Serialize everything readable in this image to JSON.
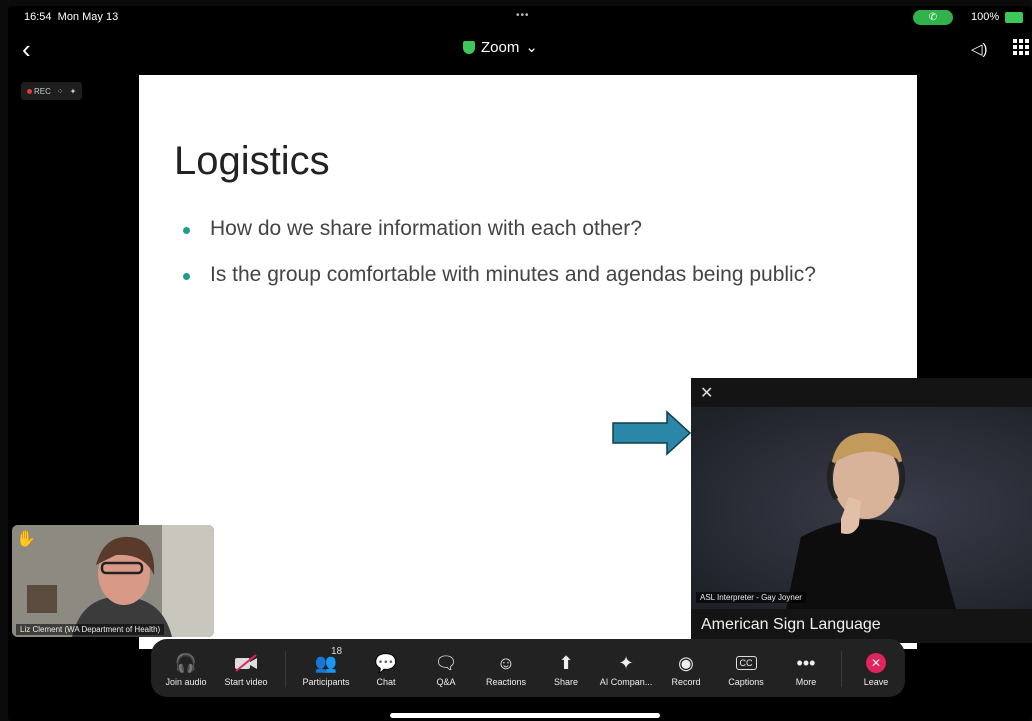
{
  "status": {
    "time": "16:54",
    "date": "Mon May 13",
    "battery": "100%"
  },
  "app": {
    "title": "Zoom"
  },
  "recording": {
    "label": "REC"
  },
  "slide": {
    "title": "Logistics",
    "bullets": [
      "How do we share information with each other?",
      "Is the group comfortable with minutes and agendas being public?"
    ]
  },
  "interpreter": {
    "name": "ASL Interpreter - Gay Joyner",
    "language_label": "American Sign Language"
  },
  "self_view": {
    "name": "Liz Clement (WA Department of Health)"
  },
  "toolbar": {
    "join_audio": "Join audio",
    "start_video": "Start video",
    "participants": "Participants",
    "participants_count": "18",
    "chat": "Chat",
    "qa": "Q&A",
    "reactions": "Reactions",
    "share": "Share",
    "ai_companion": "AI Compan...",
    "record": "Record",
    "captions": "Captions",
    "more": "More",
    "leave": "Leave"
  },
  "colors": {
    "accent": "#1f9c8e",
    "arrow": "#2a87a8",
    "leave": "#e0245e",
    "shield": "#3ec85a"
  }
}
